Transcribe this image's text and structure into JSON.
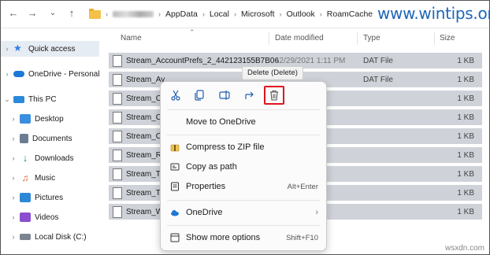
{
  "address": {
    "crumbs": [
      "AppData",
      "Local",
      "Microsoft",
      "Outlook",
      "RoamCache"
    ]
  },
  "watermark": "www.wintips.org",
  "sidebar": {
    "items": [
      {
        "label": "Quick access",
        "icon": "star-icon",
        "color": "#2f7de1"
      },
      {
        "label": "OneDrive - Personal",
        "icon": "cloud-icon",
        "color": "#1e78d6"
      },
      {
        "label": "This PC",
        "icon": "pc-icon",
        "color": "#2a8ad8"
      },
      {
        "label": "Desktop",
        "icon": "desktop-icon",
        "color": "#3a8fe0"
      },
      {
        "label": "Documents",
        "icon": "documents-icon",
        "color": "#6b7d93"
      },
      {
        "label": "Downloads",
        "icon": "downloads-icon",
        "color": "#1a9d5c"
      },
      {
        "label": "Music",
        "icon": "music-icon",
        "color": "#e85a2a"
      },
      {
        "label": "Pictures",
        "icon": "pictures-icon",
        "color": "#2d89d8"
      },
      {
        "label": "Videos",
        "icon": "videos-icon",
        "color": "#8a4fd1"
      },
      {
        "label": "Local Disk (C:)",
        "icon": "disk-icon",
        "color": "#7a8591"
      }
    ]
  },
  "columns": {
    "name": "Name",
    "date": "Date modified",
    "type": "Type",
    "size": "Size"
  },
  "files": [
    {
      "name": "Stream_AccountPrefs_2_442123155B7B06",
      "date": "12/29/2021 1:11 PM",
      "type": "DAT File",
      "size": "1 KB"
    },
    {
      "name": "Stream_Av",
      "date": "",
      "type": "DAT File",
      "size": "1 KB"
    },
    {
      "name": "Stream_Ca",
      "date": "",
      "type": "",
      "size": "1 KB"
    },
    {
      "name": "Stream_Co",
      "date": "",
      "type": "",
      "size": "1 KB"
    },
    {
      "name": "Stream_Co",
      "date": "",
      "type": "",
      "size": "1 KB"
    },
    {
      "name": "Stream_Rs",
      "date": "",
      "type": "",
      "size": "1 KB"
    },
    {
      "name": "Stream_Ta",
      "date": "",
      "type": "",
      "size": "1 KB"
    },
    {
      "name": "Stream_TC",
      "date": "",
      "type": "",
      "size": "1 KB"
    },
    {
      "name": "Stream_W",
      "date": "",
      "type": "",
      "size": "1 KB"
    }
  ],
  "tooltip": "Delete (Delete)",
  "menu": {
    "move_onedrive": "Move to OneDrive",
    "compress": "Compress to ZIP file",
    "copy_path": "Copy as path",
    "properties": "Properties",
    "properties_shortcut": "Alt+Enter",
    "onedrive": "OneDrive",
    "more": "Show more options",
    "more_shortcut": "Shift+F10"
  },
  "corner_watermark": "wsxdn.com",
  "colors": {
    "highlight_border": "#e0141e",
    "selection": "#cfd3d9",
    "accent": "#1f66b8"
  }
}
